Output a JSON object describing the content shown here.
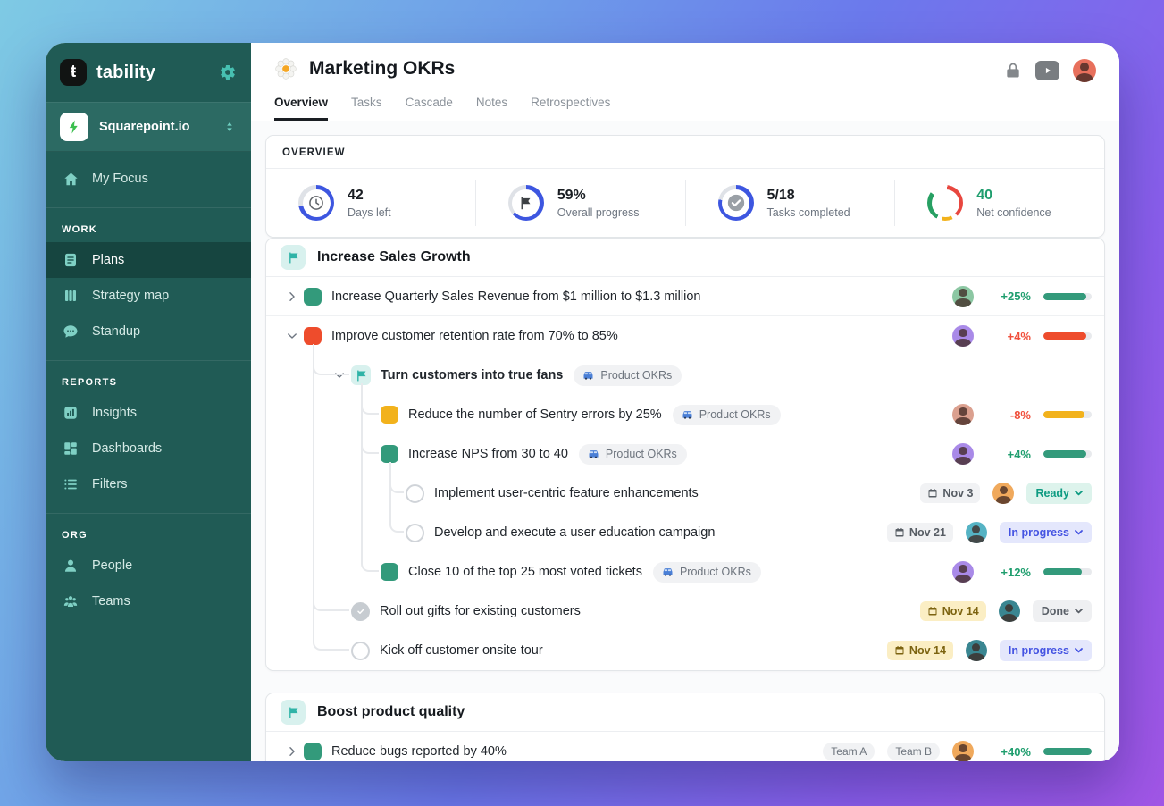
{
  "app": {
    "brand": "tability",
    "workspace": "Squarepoint.io"
  },
  "sidebar": {
    "sections": [
      {
        "label": null,
        "items": [
          {
            "id": "my-focus",
            "label": "My Focus",
            "icon": "home"
          }
        ]
      },
      {
        "label": "WORK",
        "items": [
          {
            "id": "plans",
            "label": "Plans",
            "icon": "doc",
            "active": true
          },
          {
            "id": "strategy-map",
            "label": "Strategy map",
            "icon": "columns"
          },
          {
            "id": "standup",
            "label": "Standup",
            "icon": "chat"
          }
        ]
      },
      {
        "label": "REPORTS",
        "items": [
          {
            "id": "insights",
            "label": "Insights",
            "icon": "chart"
          },
          {
            "id": "dashboards",
            "label": "Dashboards",
            "icon": "grid"
          },
          {
            "id": "filters",
            "label": "Filters",
            "icon": "list"
          }
        ]
      },
      {
        "label": "ORG",
        "items": [
          {
            "id": "people",
            "label": "People",
            "icon": "person"
          },
          {
            "id": "teams",
            "label": "Teams",
            "icon": "people"
          }
        ]
      }
    ]
  },
  "header": {
    "title": "Marketing OKRs",
    "tabs": [
      {
        "id": "overview",
        "label": "Overview",
        "active": true
      },
      {
        "id": "tasks",
        "label": "Tasks"
      },
      {
        "id": "cascade",
        "label": "Cascade"
      },
      {
        "id": "notes",
        "label": "Notes"
      },
      {
        "id": "retrospectives",
        "label": "Retrospectives"
      }
    ],
    "avatar_color": "#e8705c"
  },
  "overview": {
    "label": "OVERVIEW",
    "metrics": [
      {
        "value": "42",
        "label": "Days left",
        "icon": "clock",
        "ring_pct": 72
      },
      {
        "value": "59%",
        "label": "Overall progress",
        "icon": "flag",
        "ring_pct": 64
      },
      {
        "value": "5/18",
        "label": "Tasks completed",
        "icon": "check",
        "ring_pct": 78
      },
      {
        "value": "40",
        "label": "Net confidence",
        "icon": null,
        "value_color": "#1f9e6e",
        "ring_segments": [
          [
            "#e8473f",
            2,
            38
          ],
          [
            "#f2b21c",
            43,
            53
          ],
          [
            "#27a063",
            58,
            85
          ]
        ]
      }
    ]
  },
  "colors": {
    "green": "#339a7b",
    "red": "#ee4c2c",
    "yellow": "#f2b21c",
    "blue": "#3d56e0",
    "track": "#e8eaed",
    "delta_green": "#1f9e6e",
    "delta_red": "#f04f3b"
  },
  "cards": [
    {
      "title": "Increase Sales Growth",
      "rows": [
        {
          "depth": 0,
          "chevron": "right",
          "marker": "square",
          "color": "green",
          "divider": true,
          "title": "Increase Quarterly Sales Revenue from $1 million to $1.3 million",
          "right": {
            "avatar": "#8cc7a3",
            "delta": "+25%",
            "delta_color": "delta_green",
            "bar": "green",
            "pct": 88
          }
        },
        {
          "depth": 0,
          "chevron": "down",
          "marker": "square",
          "color": "red",
          "title": "Improve customer retention rate from 70% to 85%",
          "right": {
            "avatar": "#a98ae8",
            "delta": "+4%",
            "delta_color": "delta_red",
            "bar": "red",
            "pct": 88
          }
        },
        {
          "depth": 1,
          "chevron": "down",
          "marker": "flag",
          "bold": true,
          "title": "Turn customers into true fans",
          "tag": "Product OKRs"
        },
        {
          "depth": 2,
          "marker": "square",
          "color": "yellow",
          "title": "Reduce the number of Sentry errors by 25%",
          "tag": "Product OKRs",
          "right": {
            "avatar": "#dba08f",
            "delta": "-8%",
            "delta_color": "delta_red",
            "bar": "yellow",
            "pct": 85
          }
        },
        {
          "depth": 2,
          "marker": "square",
          "color": "green",
          "title": "Increase NPS from 30 to 40",
          "tag": "Product OKRs",
          "right": {
            "avatar": "#a98ae8",
            "delta": "+4%",
            "delta_color": "delta_green",
            "bar": "green",
            "pct": 88
          }
        },
        {
          "depth": 3,
          "marker": "circle",
          "title": "Implement user-centric feature enhancements",
          "right": {
            "date": "Nov 3",
            "date_style": "gray",
            "avatar": "#f0a95c",
            "status": "Ready",
            "status_style": "ready"
          }
        },
        {
          "depth": 3,
          "marker": "circle",
          "title": "Develop and execute a user education campaign",
          "right": {
            "date": "Nov 21",
            "date_style": "gray",
            "avatar": "#55b3c4",
            "status": "In progress",
            "status_style": "inprogress"
          }
        },
        {
          "depth": 2,
          "marker": "square",
          "color": "green",
          "title": "Close 10 of the top 25 most voted tickets",
          "tag": "Product OKRs",
          "right": {
            "avatar": "#a98ae8",
            "delta": "+12%",
            "delta_color": "delta_green",
            "bar": "green",
            "pct": 80
          }
        },
        {
          "depth": 1,
          "marker": "check",
          "title": "Roll out gifts for existing customers",
          "right": {
            "date": "Nov 14",
            "date_style": "yellow",
            "avatar": "#3a8691",
            "status": "Done",
            "status_style": "done"
          }
        },
        {
          "depth": 1,
          "marker": "circle",
          "title": "Kick off customer onsite tour",
          "right": {
            "date": "Nov 14",
            "date_style": "yellow",
            "avatar": "#3a8691",
            "status": "In progress",
            "status_style": "inprogress"
          }
        }
      ]
    },
    {
      "title": "Boost product quality",
      "rows": [
        {
          "depth": 0,
          "chevron": "right",
          "marker": "square",
          "color": "green",
          "title": "Reduce bugs reported by 40%",
          "right": {
            "tags": [
              "Team A",
              "Team B"
            ],
            "avatar": "#f0a95c",
            "delta": "+40%",
            "delta_color": "delta_green",
            "bar": "green",
            "pct": 100
          }
        }
      ]
    }
  ]
}
